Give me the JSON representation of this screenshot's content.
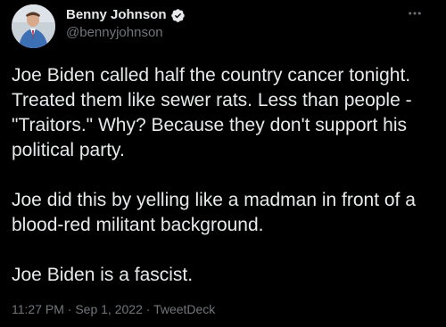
{
  "author": {
    "display_name": "Benny Johnson",
    "handle": "@bennyjohnson",
    "verified": true,
    "verified_color": "#1d9bf0"
  },
  "menu": {
    "icon": "more-horizontal-icon"
  },
  "tweet": {
    "paragraphs": [
      "Joe Biden called half the country cancer tonight. Treated them like sewer rats. Less than people - \"Traitors.\" Why? Because they don't support his political party.",
      "Joe did this by yelling like a madman in front of a blood-red militant background.",
      "Joe Biden is a fascist."
    ],
    "time": "11:27 PM",
    "date": "Sep 1, 2022",
    "source": "TweetDeck",
    "separator": "·"
  },
  "colors": {
    "background": "#000000",
    "text": "#e7e9ea",
    "secondary_text": "#71767b"
  }
}
